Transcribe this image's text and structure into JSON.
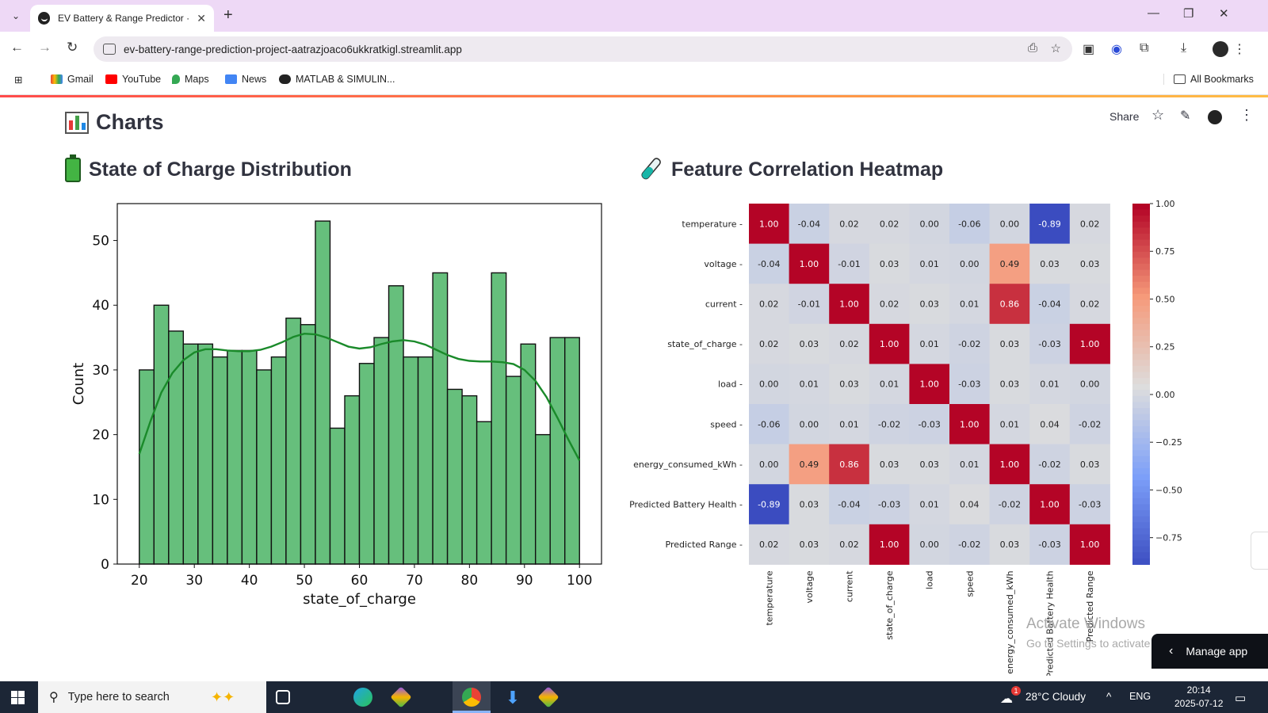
{
  "browser": {
    "tab_title": "EV Battery & Range Predictor · S",
    "url": "ev-battery-range-prediction-project-aatrazjoaco6ukkratkigl.streamlit.app",
    "bookmarks": [
      "Gmail",
      "YouTube",
      "Maps",
      "News",
      "MATLAB & SIMULIN..."
    ],
    "all_bookmarks": "All Bookmarks"
  },
  "app": {
    "page_title": "Charts",
    "share_label": "Share",
    "soc_title": "State of Charge Distribution",
    "heatmap_title": "Feature Correlation Heatmap",
    "manage_app_label": "Manage app",
    "watermark_title": "Activate Windows",
    "watermark_sub": "Go to Settings to activate Windows."
  },
  "taskbar": {
    "search_placeholder": "Type here to search",
    "weather": "28°C  Cloudy",
    "weather_badge": "1",
    "language": "ENG",
    "time": "20:14",
    "date": "2025-07-12",
    "notification_count": "1"
  },
  "chart_data": [
    {
      "type": "bar",
      "subtype": "histogram_with_kde",
      "title": "",
      "xlabel": "state_of_charge",
      "ylabel": "Count",
      "bin_start": 20,
      "bin_width": 2.6667,
      "values": [
        30,
        40,
        36,
        34,
        34,
        32,
        33,
        33,
        30,
        32,
        38,
        37,
        53,
        21,
        26,
        31,
        35,
        43,
        32,
        32,
        45,
        27,
        26,
        22,
        45,
        29,
        34,
        20,
        35,
        35
      ],
      "xlim": [
        16,
        104
      ],
      "ylim": [
        0,
        55.7
      ],
      "xticks": [
        20,
        30,
        40,
        50,
        60,
        70,
        80,
        90,
        100
      ],
      "yticks": [
        0,
        10,
        20,
        30,
        40,
        50
      ],
      "bar_color": "#66bf7c",
      "kde_color": "#1a8a2a",
      "kde_x": [
        20,
        22,
        24,
        26,
        28,
        30,
        32,
        34,
        36,
        38,
        40,
        42,
        44,
        46,
        48,
        50,
        52,
        54,
        56,
        58,
        60,
        62,
        64,
        66,
        68,
        70,
        72,
        74,
        76,
        78,
        80,
        82,
        84,
        86,
        88,
        90,
        92,
        94,
        96,
        98,
        100
      ],
      "kde_y": [
        17,
        22,
        26.5,
        29.5,
        31.5,
        32.7,
        33.2,
        33.2,
        33,
        32.9,
        32.9,
        33.1,
        33.6,
        34.3,
        35.1,
        35.6,
        35.5,
        35,
        34.3,
        33.6,
        33.3,
        33.5,
        34,
        34.4,
        34.6,
        34.4,
        33.9,
        33.1,
        32.3,
        31.7,
        31.4,
        31.3,
        31.3,
        31.2,
        30.9,
        30,
        28.3,
        25.8,
        22.6,
        19.2,
        16
      ]
    },
    {
      "type": "heatmap",
      "title": "",
      "labels": [
        "temperature",
        "voltage",
        "current",
        "state_of_charge",
        "load",
        "speed",
        "energy_consumed_kWh",
        "Predicted Battery Health",
        "Predicted Range"
      ],
      "matrix": [
        [
          1.0,
          -0.04,
          0.02,
          0.02,
          0.0,
          -0.06,
          0.0,
          -0.89,
          0.02
        ],
        [
          -0.04,
          1.0,
          -0.01,
          0.03,
          0.01,
          0.0,
          0.49,
          0.03,
          0.03
        ],
        [
          0.02,
          -0.01,
          1.0,
          0.02,
          0.03,
          0.01,
          0.86,
          -0.04,
          0.02
        ],
        [
          0.02,
          0.03,
          0.02,
          1.0,
          0.01,
          -0.02,
          0.03,
          -0.03,
          1.0
        ],
        [
          0.0,
          0.01,
          0.03,
          0.01,
          1.0,
          -0.03,
          0.03,
          0.01,
          0.0
        ],
        [
          -0.06,
          0.0,
          0.01,
          -0.02,
          -0.03,
          1.0,
          0.01,
          0.04,
          -0.02
        ],
        [
          0.0,
          0.49,
          0.86,
          0.03,
          0.03,
          0.01,
          1.0,
          -0.02,
          0.03
        ],
        [
          -0.89,
          0.03,
          -0.04,
          -0.03,
          0.01,
          0.04,
          -0.02,
          1.0,
          -0.03
        ],
        [
          0.02,
          0.03,
          0.02,
          1.0,
          0.0,
          -0.02,
          0.03,
          -0.03,
          1.0
        ]
      ],
      "colormap": "coolwarm",
      "vmin": -0.89,
      "vmax": 1.0,
      "colorbar_ticks": [
        1.0,
        0.75,
        0.5,
        0.25,
        0.0,
        -0.25,
        -0.5,
        -0.75
      ],
      "colorbar_tick_labels": [
        "1.00",
        "0.75",
        "0.50",
        "0.25",
        "0.00",
        "−0.25",
        "−0.50",
        "−0.75"
      ]
    }
  ]
}
